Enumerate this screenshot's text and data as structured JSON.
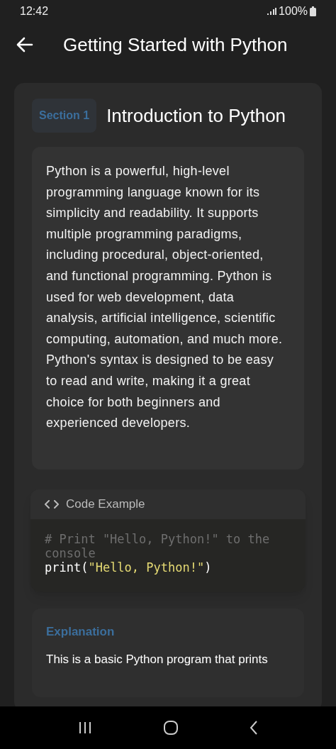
{
  "status_bar": {
    "time": "12:42",
    "battery": "100%"
  },
  "app_bar": {
    "title": "Getting Started with Python"
  },
  "section": {
    "badge": "Section 1",
    "title": "Introduction to Python",
    "paragraphs": [
      "Python is a powerful, high-level programming language known for its simplicity and readability. It supports multiple programming paradigms, including procedural, object-oriented, and functional programming. Python is used for web development, data analysis, artificial intelligence, scientific computing, automation, and much more.",
      "Python's syntax is designed to be easy to read and write, making it a great choice for both beginners and experienced developers."
    ],
    "code_example": {
      "header": "Code Example",
      "comment": "# Print \"Hello, Python!\" to the console",
      "func": "print(",
      "string": "\"Hello, Python!\"",
      "close": ")"
    },
    "explanation": {
      "title": "Explanation",
      "text": "This is a basic Python program that prints"
    }
  }
}
